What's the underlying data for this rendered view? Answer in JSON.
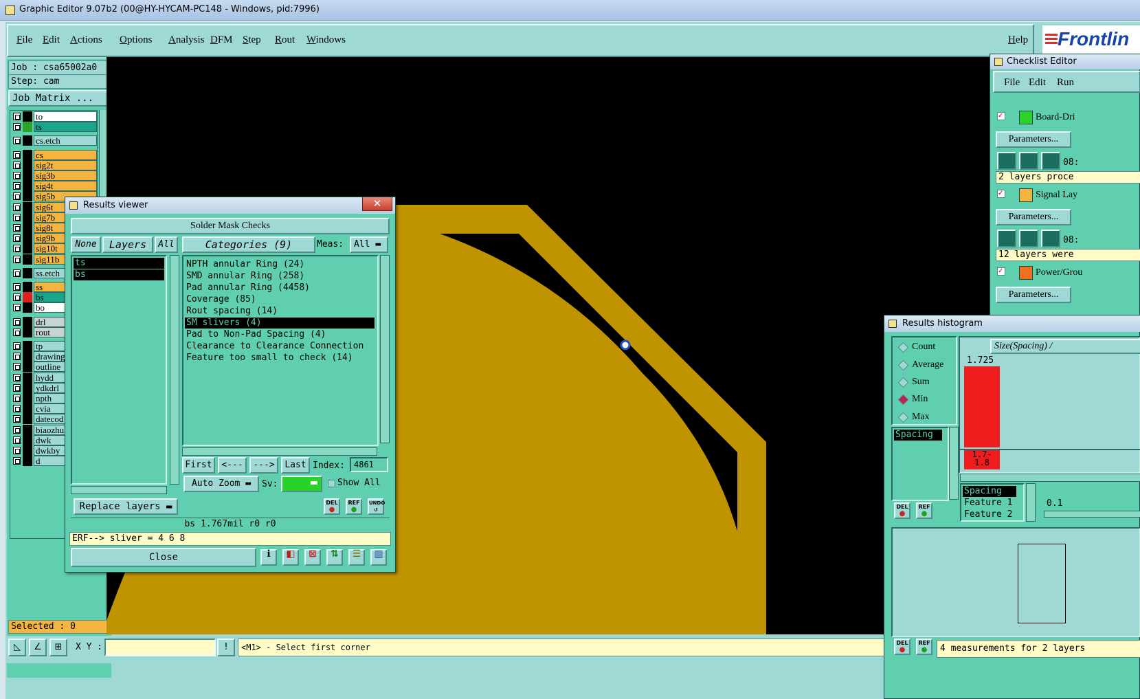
{
  "window": {
    "title": "Graphic Editor 9.07b2 (00@HY-HYCAM-PC148 - Windows, pid:7996)"
  },
  "menu": {
    "items": [
      "File",
      "Edit",
      "Actions",
      "Options",
      "Analysis",
      "DFM",
      "Step",
      "Rout",
      "Windows"
    ],
    "help": "Help"
  },
  "logo": {
    "text": "Frontlin"
  },
  "job": {
    "job_label": "Job : csa65002a0",
    "step_label": "Step: cam",
    "matrix_button": "Job Matrix ..."
  },
  "layers": [
    {
      "name": "to",
      "color": "#ffffff",
      "swatch": "#000000"
    },
    {
      "name": "ts",
      "color": "#1aa58a",
      "swatch": "#2aa52a"
    },
    {
      "name": "cs.etch",
      "color": "#9fd9d6",
      "swatch": "#000000"
    },
    {
      "name": "cs",
      "color": "#f3b440",
      "swatch": "#000000"
    },
    {
      "name": "sig2t",
      "color": "#f3b440",
      "swatch": "#000000"
    },
    {
      "name": "sig3b",
      "color": "#f3b440",
      "swatch": "#000000"
    },
    {
      "name": "sig4t",
      "color": "#f3b440",
      "swatch": "#000000"
    },
    {
      "name": "sig5b",
      "color": "#f3b440",
      "swatch": "#000000"
    },
    {
      "name": "sig6t",
      "color": "#f3b440",
      "swatch": "#000000"
    },
    {
      "name": "sig7b",
      "color": "#f3b440",
      "swatch": "#000000"
    },
    {
      "name": "sig8t",
      "color": "#f3b440",
      "swatch": "#000000"
    },
    {
      "name": "sig9b",
      "color": "#f3b440",
      "swatch": "#000000"
    },
    {
      "name": "sig10t",
      "color": "#f3b440",
      "swatch": "#000000"
    },
    {
      "name": "sig11b",
      "color": "#f3b440",
      "swatch": "#000000"
    },
    {
      "name": "ss.etch",
      "color": "#9fd9d6",
      "swatch": "#000000"
    },
    {
      "name": "ss",
      "color": "#f3b440",
      "swatch": "#000000"
    },
    {
      "name": "bs",
      "color": "#1aa58a",
      "swatch": "#e02020"
    },
    {
      "name": "bo",
      "color": "#ffffff",
      "swatch": "#000000"
    },
    {
      "name": "drl",
      "color": "#c8d4d4",
      "swatch": "#000000"
    },
    {
      "name": "rout",
      "color": "#c8d4d4",
      "swatch": "#000000"
    },
    {
      "name": "tp",
      "color": "#9fd9d6",
      "swatch": "#000000"
    },
    {
      "name": "drawing",
      "color": "#9fd9d6",
      "swatch": "#000000"
    },
    {
      "name": "outline",
      "color": "#9fd9d6",
      "swatch": "#000000"
    },
    {
      "name": "hydd",
      "color": "#9fd9d6",
      "swatch": "#000000"
    },
    {
      "name": "ydkdrl",
      "color": "#9fd9d6",
      "swatch": "#000000"
    },
    {
      "name": "npth",
      "color": "#9fd9d6",
      "swatch": "#000000"
    },
    {
      "name": "cvia",
      "color": "#9fd9d6",
      "swatch": "#000000"
    },
    {
      "name": "datecod",
      "color": "#9fd9d6",
      "swatch": "#000000"
    },
    {
      "name": "biaozhu",
      "color": "#9fd9d6",
      "swatch": "#000000"
    },
    {
      "name": "dwk",
      "color": "#9fd9d6",
      "swatch": "#000000"
    },
    {
      "name": "dwkby",
      "color": "#9fd9d6",
      "swatch": "#000000"
    },
    {
      "name": "d",
      "color": "#9fd9d6",
      "swatch": "#000000"
    }
  ],
  "selected_label": "Selected : 0",
  "bottom": {
    "xy_label": "X Y :",
    "xy_value": "",
    "status": "<M1> - Select first corner",
    "bang": "!"
  },
  "results_viewer": {
    "title": "Results viewer",
    "header": "Solder Mask Checks",
    "none_btn": "None",
    "layers_btn": "Layers",
    "all_btn": "All",
    "categories_btn": "Categories (9)",
    "meas_label": "Meas:",
    "meas_value": "All",
    "layer_items": [
      "ts",
      "bs"
    ],
    "categories": [
      "NPTH annular Ring (24)",
      "SMD annular Ring (258)",
      "Pad annular Ring (4458)",
      "Coverage (85)",
      "Rout spacing (14)",
      "SM slivers (4)",
      "Pad to Non-Pad Spacing (4)",
      "Clearance to Clearance Connection",
      "Feature too small to check (14)"
    ],
    "selected_category": 5,
    "first": "First",
    "prev": "<---",
    "next": "--->",
    "last": "Last",
    "index_label": "Index:",
    "index_value": "4861",
    "auto_zoom": "Auto Zoom",
    "sv_label": "Sv:",
    "show_all": "Show All",
    "replace_layers": "Replace layers",
    "del": "DEL",
    "ref": "REF",
    "undo": "UNDO",
    "status_line": "bs 1.767mil  r0  r0",
    "erf_line": "ERF--> sliver = 4 6 8",
    "close": "Close"
  },
  "checklist_editor": {
    "title": "Checklist Editor",
    "menu": [
      "File",
      "Edit",
      "Run"
    ],
    "checks": [
      {
        "name": "Board-Dri",
        "time": "08:",
        "message": "2 layers proce"
      },
      {
        "name": "Signal Lay",
        "time": "08:",
        "message": "12 layers were"
      },
      {
        "name": "Power/Grou",
        "time": "",
        "message": ""
      }
    ],
    "params_label": "Parameters..."
  },
  "histogram": {
    "title": "Results histogram",
    "modes": [
      "Count",
      "Average",
      "Sum",
      "Min",
      "Max"
    ],
    "selected_mode": 3,
    "list_item": "Spacing",
    "chart_title": "Size(Spacing) /",
    "top_value": "1.725",
    "bar_color": "#ee1c1c",
    "bin_label": "1.7-\n1.8",
    "legend": [
      "Spacing",
      "Feature 1",
      "Feature 2"
    ],
    "scale_value": "0.1",
    "del": "DEL",
    "ref": "REF",
    "status": "4 measurements for 2 layers"
  }
}
